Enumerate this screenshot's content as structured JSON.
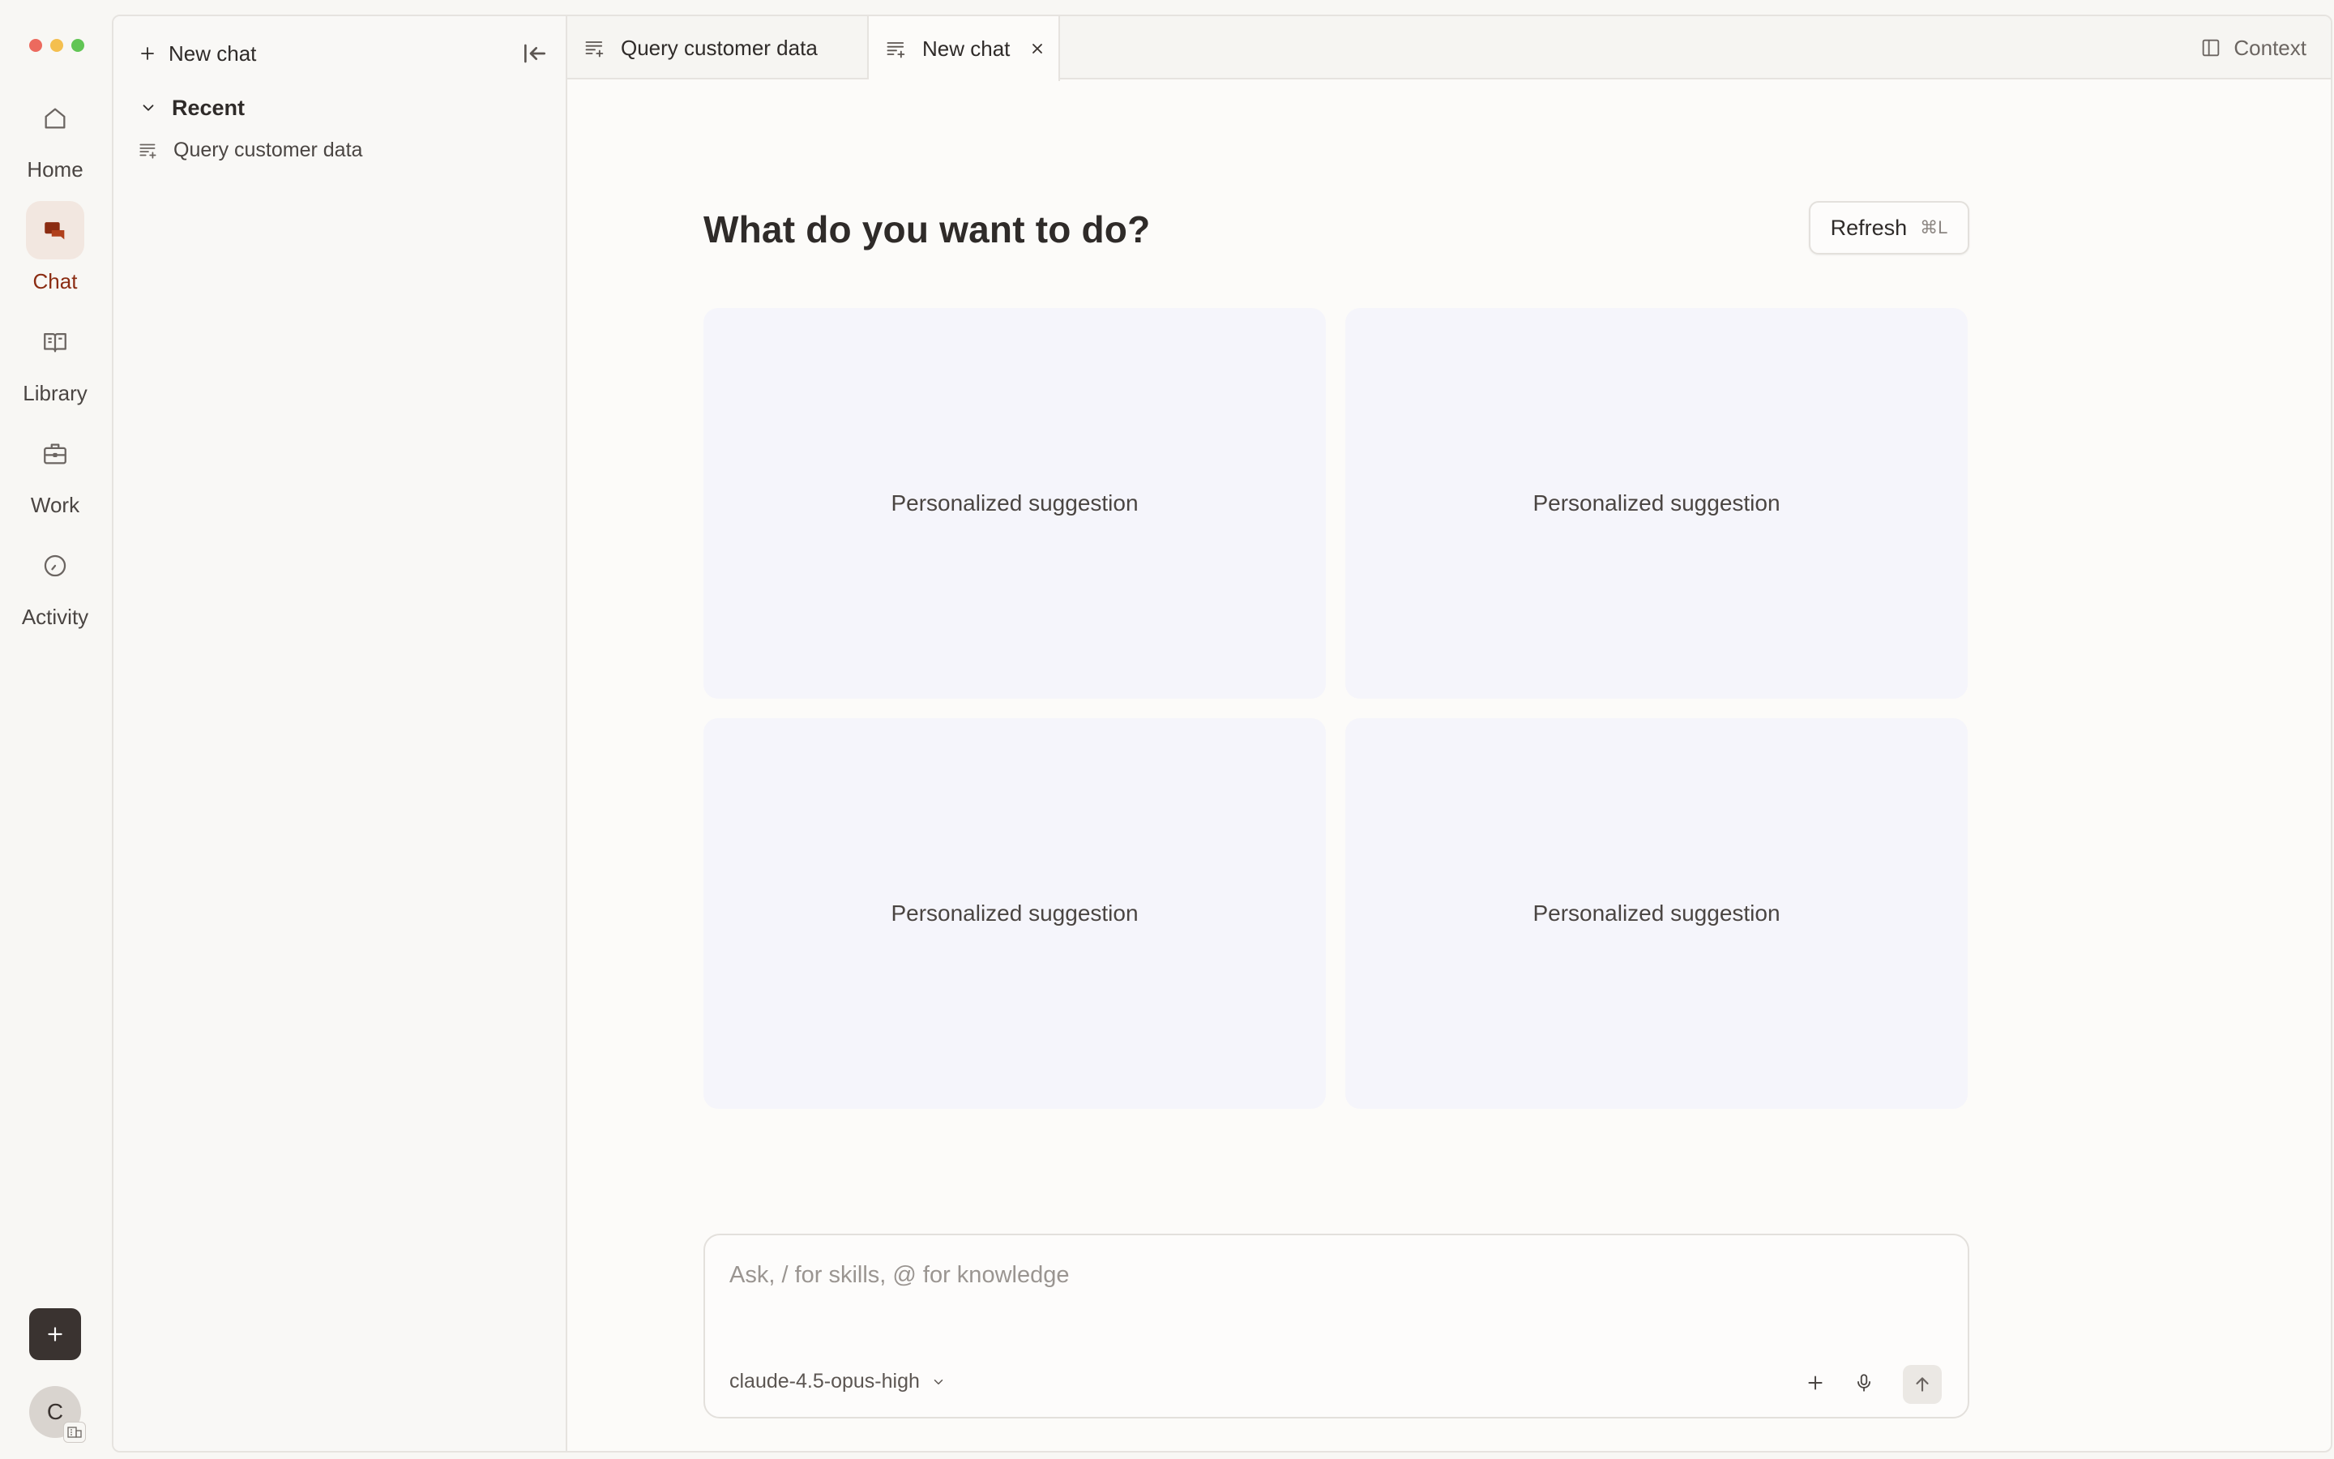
{
  "rail": {
    "items": [
      {
        "label": "Home",
        "icon": "home-icon"
      },
      {
        "label": "Chat",
        "icon": "chat-icon",
        "active": true
      },
      {
        "label": "Library",
        "icon": "book-icon"
      },
      {
        "label": "Work",
        "icon": "briefcase-icon"
      },
      {
        "label": "Activity",
        "icon": "clock-icon"
      }
    ],
    "avatar_initial": "C"
  },
  "sidebar": {
    "new_chat_label": "New chat",
    "recent_label": "Recent",
    "recent_items": [
      "Query customer data"
    ]
  },
  "tabs": [
    {
      "label": "Query customer data",
      "active": false
    },
    {
      "label": "New chat",
      "active": true
    }
  ],
  "header": {
    "context_label": "Context"
  },
  "main": {
    "heading": "What do you want to do?",
    "refresh_label": "Refresh",
    "refresh_shortcut": "⌘L",
    "suggestions": [
      "Personalized suggestion",
      "Personalized suggestion",
      "Personalized suggestion",
      "Personalized suggestion"
    ]
  },
  "composer": {
    "placeholder": "Ask, / for skills, @ for knowledge",
    "model": "claude-4.5-opus-high"
  },
  "colors": {
    "accent": "#8b2c12",
    "active_bg": "#f2e7e0",
    "card_bg": "#f5f5fb"
  }
}
